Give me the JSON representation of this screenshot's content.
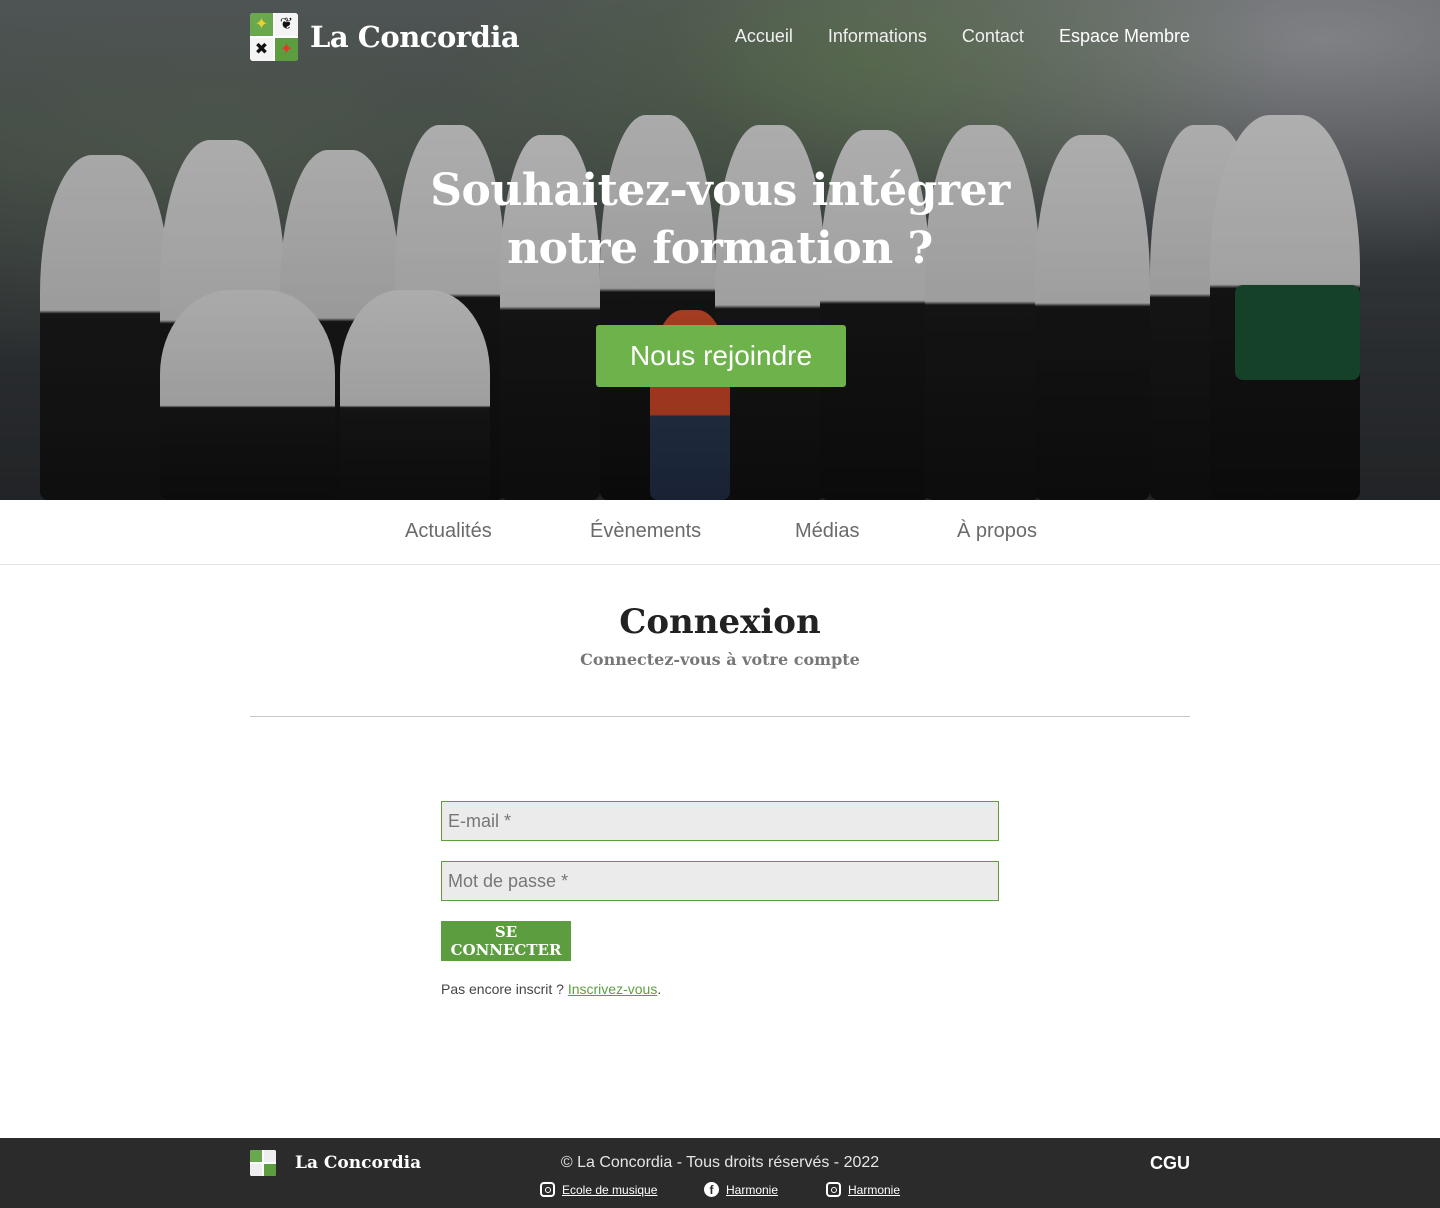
{
  "header": {
    "brand_name": "La Concordia",
    "nav": [
      "Accueil",
      "Informations",
      "Contact",
      "Espace Membre"
    ]
  },
  "hero": {
    "title_line1": "Souhaitez-vous intégrer",
    "title_line2": "notre formation ?",
    "cta_label": "Nous rejoindre"
  },
  "subnav": [
    "Actualités",
    "Évènements",
    "Médias",
    "À propos"
  ],
  "login": {
    "title": "Connexion",
    "subtitle": "Connectez-vous à votre compte",
    "email_placeholder": "E-mail *",
    "password_placeholder": "Mot de passe *",
    "submit_label": "SE CONNECTER",
    "signup_prefix": "Pas encore inscrit ? ",
    "signup_link": "Inscrivez-vous",
    "signup_suffix": "."
  },
  "footer": {
    "brand_name": "La Concordia",
    "copyright": "© La Concordia - Tous droits réservés - 2022",
    "cgu_label": "CGU",
    "social": [
      {
        "icon": "instagram-icon",
        "label": "Ecole de musique"
      },
      {
        "icon": "facebook-icon",
        "label": "Harmonie"
      },
      {
        "icon": "instagram-icon",
        "label": "Harmonie"
      }
    ]
  },
  "colors": {
    "accent_green": "#5c9e3f",
    "cta_green": "#6db24a",
    "footer_bg": "#2b2b2b"
  }
}
